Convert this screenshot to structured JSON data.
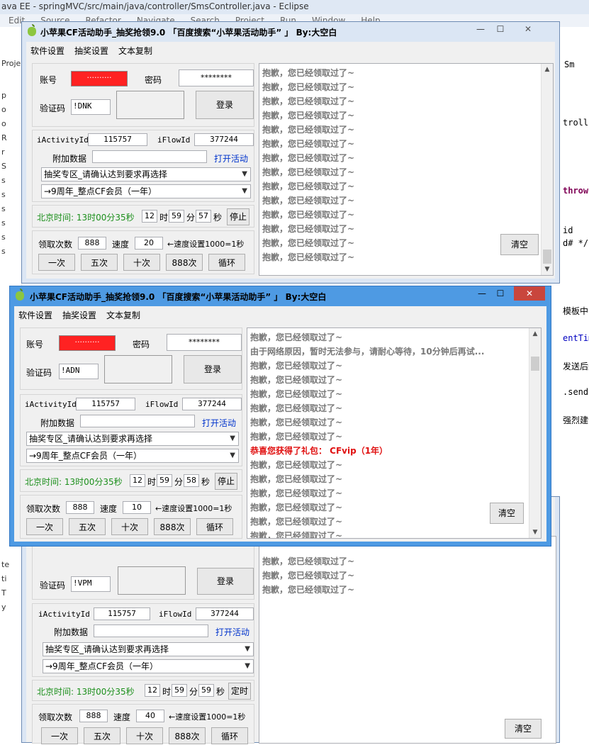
{
  "eclipse": {
    "title": "ava EE - springMVC/src/main/java/controller/SmsController.java - Eclipse",
    "menu": [
      "Edit",
      "Source",
      "Refactor",
      "Navigate",
      "Search",
      "Project",
      "Run",
      "Window",
      "Help"
    ],
    "left_items": [
      "Proje",
      "p",
      "o",
      "o",
      "R",
      "r",
      "S",
      "s",
      "s",
      "s",
      "s",
      "s",
      "s",
      "te",
      "ti",
      "T",
      "y"
    ],
    "right_tab": "Sm",
    "right_code": [
      "troll",
      "throw",
      "id",
      "d# */",
      "模板中的",
      "entTime",
      "发送后是",
      ".send(t",
      "强烈建议"
    ]
  },
  "common": {
    "menu": [
      "软件设置",
      "抽奖设置",
      "文本复制"
    ],
    "account_label": "账号",
    "password_label": "密码",
    "password_value": "********",
    "captcha_label": "验证码",
    "login_button": "登录",
    "activity_id_label": "iActivityId",
    "activity_id_value": "115757",
    "flow_id_label": "iFlowId",
    "flow_id_value": "377244",
    "extra_label": "附加数据",
    "open_activity": "打开活动",
    "select_area": "抽奖专区_请确认达到要求再选择",
    "select_prize": "→9周年_整点CF会员（一年）",
    "beijing_time": "北京时间: 13时00分35秒",
    "hour_unit": "时",
    "minute_unit": "分",
    "second_unit": "秒",
    "count_label": "领取次数",
    "count_value": "888",
    "speed_label": "速度",
    "speed_hint": "←速度设置1000=1秒",
    "btn_once": "一次",
    "btn_five": "五次",
    "btn_ten": "十次",
    "btn_888": "888次",
    "btn_loop": "循环",
    "clear_button": "清空",
    "msg_already": "抱歉，您已经领取过了~"
  },
  "window1": {
    "title": "小苹果CF活动助手_抽奖抢领9.0 「百度搜索“小苹果活动助手” 」 By:大空白",
    "min": "—",
    "max": "☐",
    "close": "✕",
    "captcha_value": "!DNK",
    "timer_h": "12",
    "timer_m": "59",
    "timer_s": "57",
    "stop_button": "停止",
    "speed_value": "20"
  },
  "window2": {
    "title": "小苹果CF活动助手_抽奖抢领9.0 「百度搜索“小苹果活动助手” 」 By:大空白",
    "min": "—",
    "max": "☐",
    "close": "✕",
    "captcha_value": "!ADN",
    "timer_h": "12",
    "timer_m": "59",
    "timer_s": "58",
    "stop_button": "停止",
    "speed_value": "10",
    "msg_network": "由于网络原因，暂时无法参与，请耐心等待，10分钟后再试...",
    "msg_win": "恭喜您获得了礼包： CFvip（1年）"
  },
  "window3": {
    "captcha_value": "!VPM",
    "timer_h": "12",
    "timer_m": "59",
    "timer_s": "59",
    "timed_button": "定时",
    "speed_value": "40"
  }
}
